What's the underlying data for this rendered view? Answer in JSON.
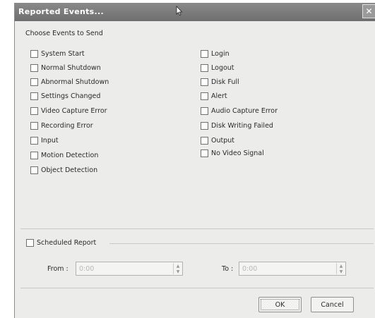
{
  "window": {
    "title": "Reported Events..."
  },
  "events": {
    "group_label": "Choose Events to Send",
    "left": [
      {
        "label": "System Start",
        "checked": false
      },
      {
        "label": "Normal Shutdown",
        "checked": false
      },
      {
        "label": "Abnormal Shutdown",
        "checked": false
      },
      {
        "label": "Settings Changed",
        "checked": false
      },
      {
        "label": "Video Capture Error",
        "checked": false
      },
      {
        "label": "Recording Error",
        "checked": false
      },
      {
        "label": "Input",
        "checked": false
      },
      {
        "label": "Motion Detection",
        "checked": false
      },
      {
        "label": "Object Detection",
        "checked": false
      }
    ],
    "right": [
      {
        "label": "Login",
        "checked": false
      },
      {
        "label": "Logout",
        "checked": false
      },
      {
        "label": "Disk Full",
        "checked": false
      },
      {
        "label": "Alert",
        "checked": false
      },
      {
        "label": "Audio Capture Error",
        "checked": false
      },
      {
        "label": "Disk Writing Failed",
        "checked": false
      },
      {
        "label": "Output",
        "checked": false
      },
      {
        "label": "No Video Signal",
        "checked": false
      }
    ]
  },
  "schedule": {
    "label": "Scheduled Report",
    "checked": false,
    "from_label": "From :",
    "from_value": "0:00",
    "to_label": "To :",
    "to_value": "0:00"
  },
  "buttons": {
    "ok": "OK",
    "cancel": "Cancel"
  }
}
